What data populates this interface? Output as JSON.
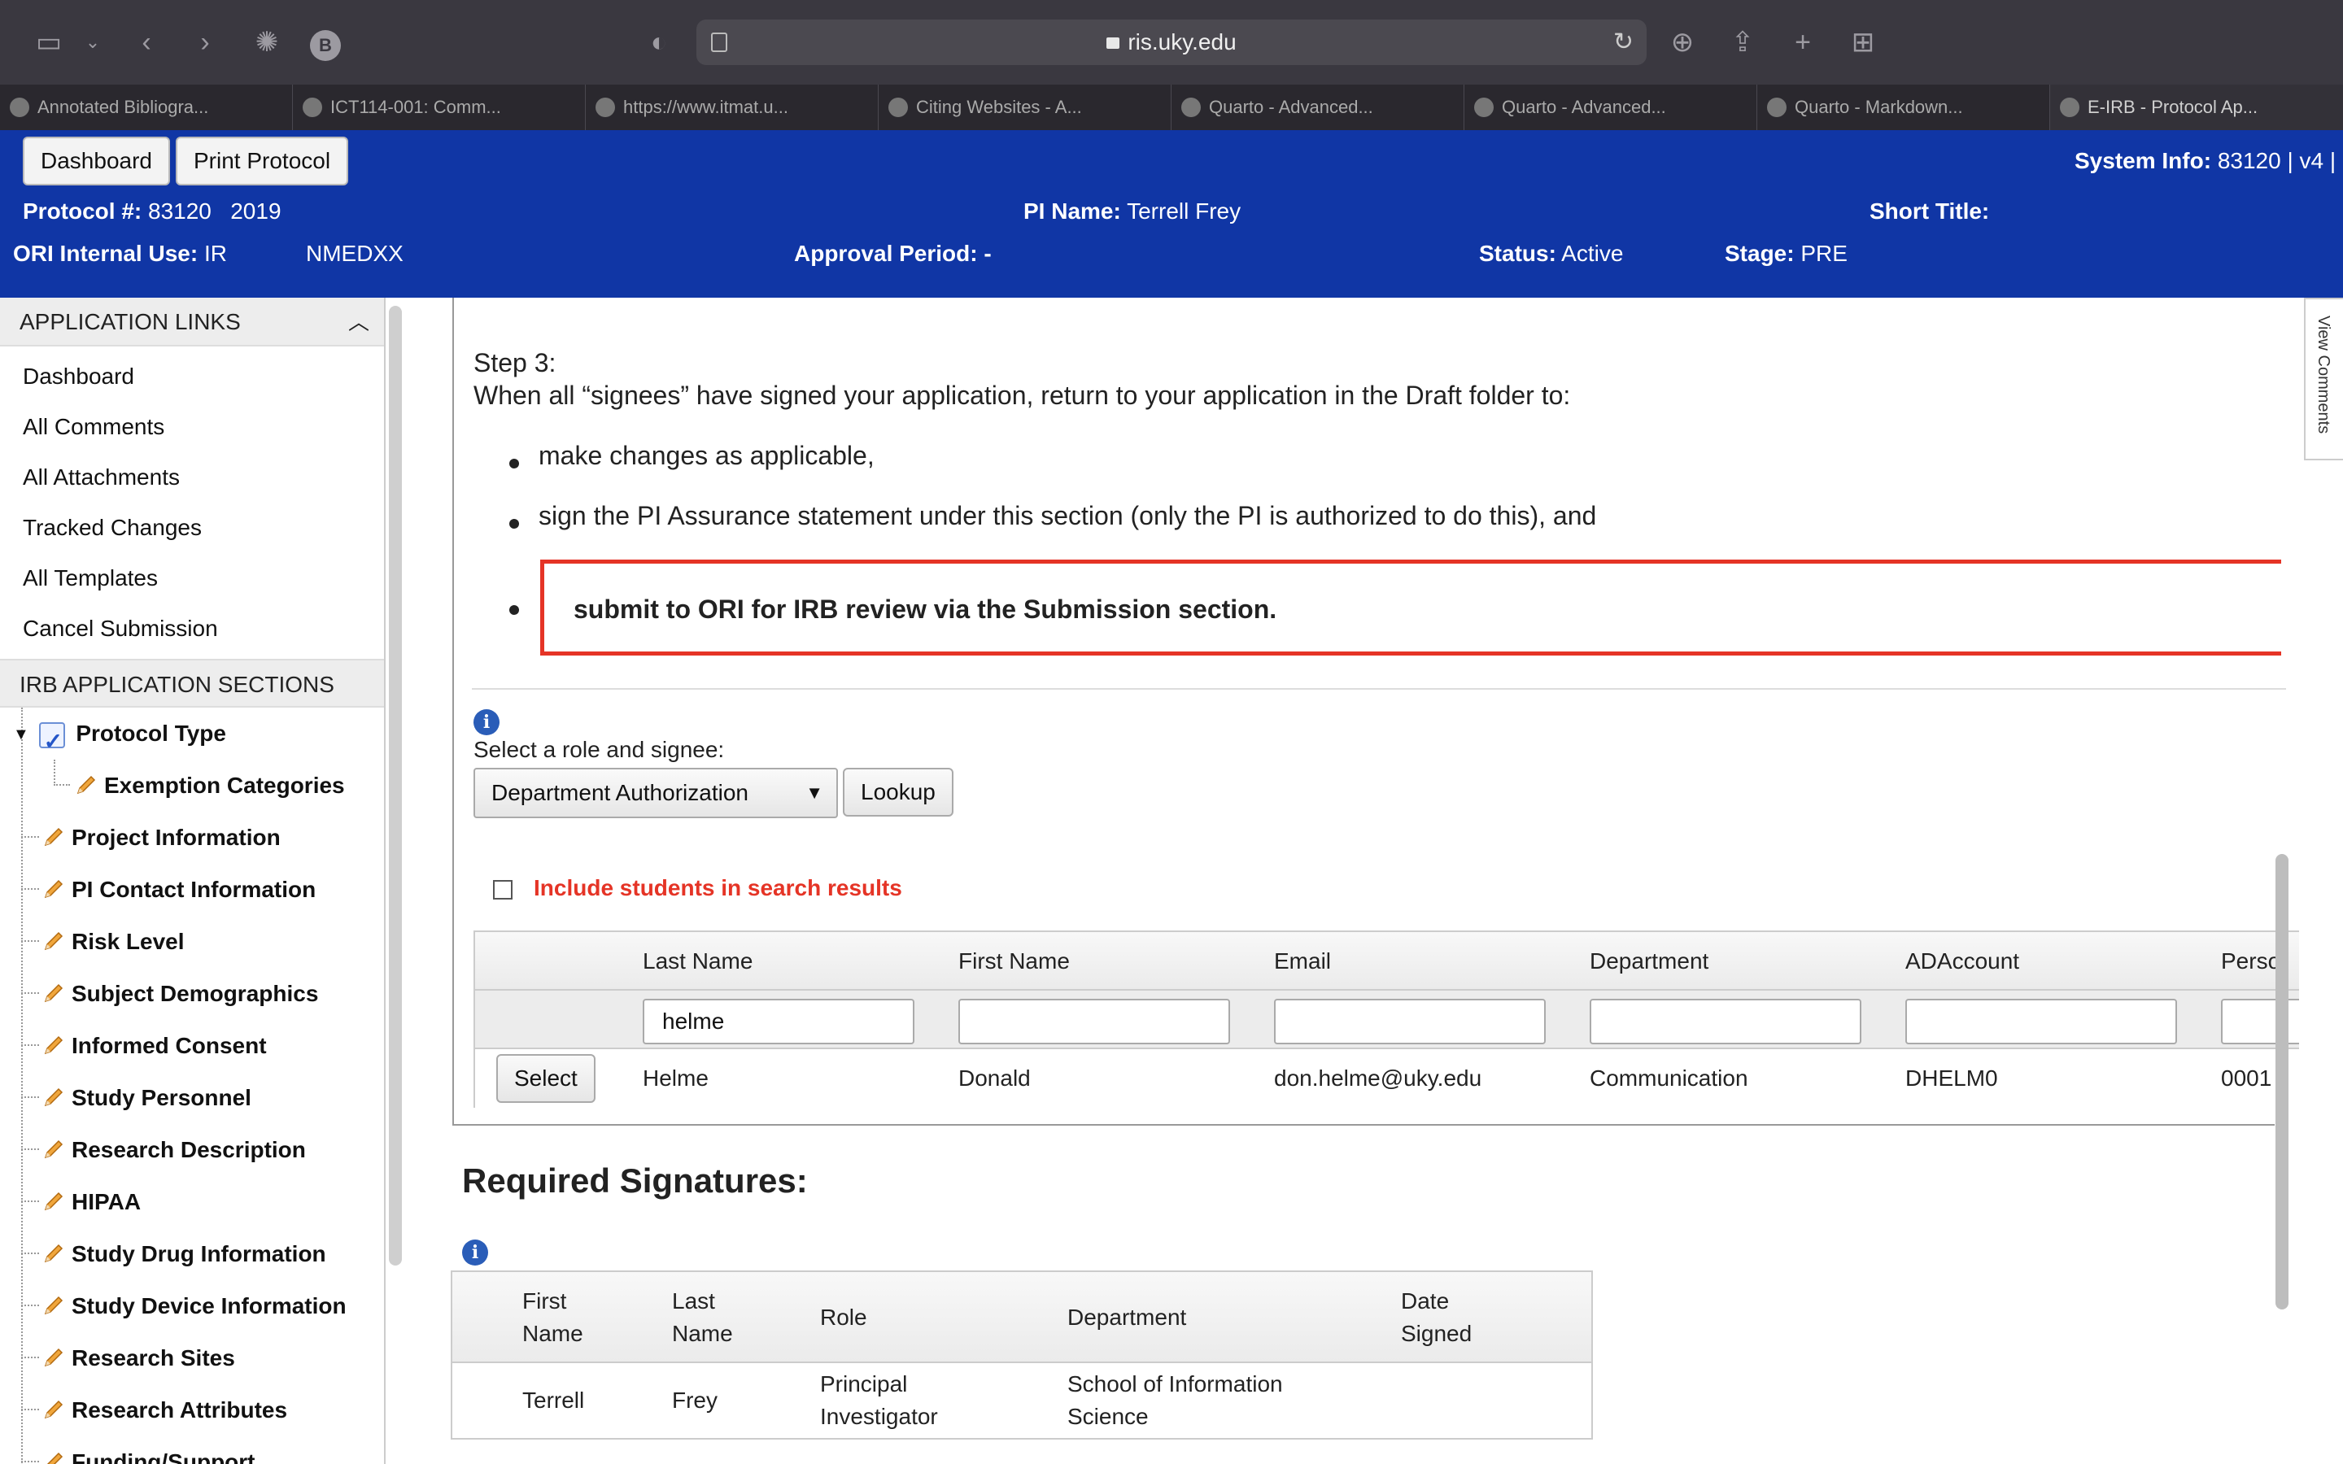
{
  "browser": {
    "url": "ris.uky.edu",
    "tabs": [
      {
        "label": "Annotated Bibliogra..."
      },
      {
        "label": "ICT114-001: Comm..."
      },
      {
        "label": "https://www.itmat.u..."
      },
      {
        "label": "Citing Websites - A..."
      },
      {
        "label": "Quarto - Advanced..."
      },
      {
        "label": "Quarto - Advanced..."
      },
      {
        "label": "Quarto - Markdown..."
      },
      {
        "label": "E-IRB - Protocol Ap..."
      }
    ]
  },
  "header": {
    "dashboard_btn": "Dashboard",
    "print_btn": "Print Protocol",
    "system_info_label": "System Info:",
    "system_info_value": "83120 | v4 |",
    "protocol_label": "Protocol #:",
    "protocol_value": "83120",
    "protocol_year": "2019",
    "pi_label": "PI Name:",
    "pi_value": "Terrell Frey",
    "short_title_label": "Short Title:",
    "ori_label": "ORI Internal Use:",
    "ori_value": "IR",
    "ori_code": "NMEDXX",
    "approval_label": "Approval Period:",
    "approval_value": "-",
    "status_label": "Status:",
    "status_value": "Active",
    "stage_label": "Stage:",
    "stage_value": "PRE"
  },
  "sidebar": {
    "links_title": "APPLICATION LINKS",
    "links": [
      "Dashboard",
      "All Comments",
      "All Attachments",
      "Tracked Changes",
      "All Templates",
      "Cancel Submission"
    ],
    "sections_title": "IRB APPLICATION SECTIONS",
    "protocol_type": "Protocol Type",
    "exemption": "Exemption Categories",
    "sections": [
      "Project Information",
      "PI Contact Information",
      "Risk Level",
      "Subject Demographics",
      "Informed Consent",
      "Study Personnel",
      "Research Description",
      "HIPAA",
      "Study Drug Information",
      "Study Device Information",
      "Research Sites",
      "Research Attributes",
      "Funding/Support"
    ]
  },
  "main": {
    "step_title": "Step 3:",
    "step_text": "When all “signees” have signed your application, return to your application in the Draft folder to:",
    "bullet1": "make changes as applicable,",
    "bullet2": "sign the PI Assurance statement under this section (only the PI is authorized to do this), and",
    "bullet3": "submit to ORI for IRB review via the Submission section.",
    "select_label": "Select a role and signee:",
    "role_value": "Department Authorization",
    "lookup_btn": "Lookup",
    "include_students": "Include students in search results",
    "grid_headers": [
      "Last Name",
      "First Name",
      "Email",
      "Department",
      "ADAccount",
      "Perso"
    ],
    "filter_last_name": "helme",
    "select_btn": "Select",
    "result": {
      "last": "Helme",
      "first": "Donald",
      "email": "don.helme@uky.edu",
      "department": "Communication",
      "adaccount": "DHELM0",
      "person": "0001"
    },
    "required_title": "Required Signatures:",
    "sig_headers": {
      "first": "First Name",
      "last": "Last Name",
      "role": "Role",
      "department": "Department",
      "date": "Date Signed"
    },
    "sig_row": {
      "first": "Terrell",
      "last": "Frey",
      "role": "Principal Investigator",
      "department": "School of Information Science",
      "date": ""
    },
    "view_comments": "View Comments"
  },
  "colors": {
    "header_blue": "#1036a5",
    "alert_red": "#e53426",
    "info_blue": "#2a5db8"
  }
}
